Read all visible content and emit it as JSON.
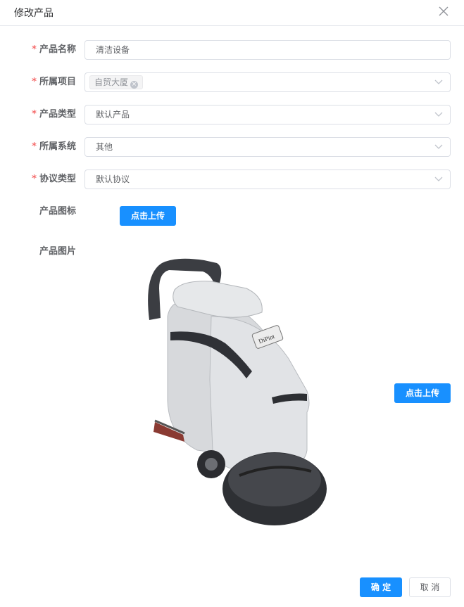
{
  "dialog": {
    "title": "修改产品"
  },
  "form": {
    "name": {
      "label": "产品名称",
      "required": "*",
      "value": "清洁设备"
    },
    "project": {
      "label": "所属项目",
      "required": "*",
      "tag": "自贸大厦",
      "tag_remove": "×"
    },
    "type": {
      "label": "产品类型",
      "required": "*",
      "value": "默认产品"
    },
    "system": {
      "label": "所属系统",
      "required": "*",
      "value": "其他"
    },
    "protocol": {
      "label": "协议类型",
      "required": "*",
      "value": "默认协议"
    },
    "icon": {
      "label": "产品图标",
      "upload_label": "点击上传"
    },
    "image": {
      "label": "产品图片",
      "upload_label": "点击上传",
      "brand_text": "DiPint"
    }
  },
  "footer": {
    "confirm_label": "确 定",
    "cancel_label": "取 消"
  },
  "colors": {
    "primary": "#1890ff",
    "required": "#f56c6c",
    "border": "#dcdfe6"
  }
}
